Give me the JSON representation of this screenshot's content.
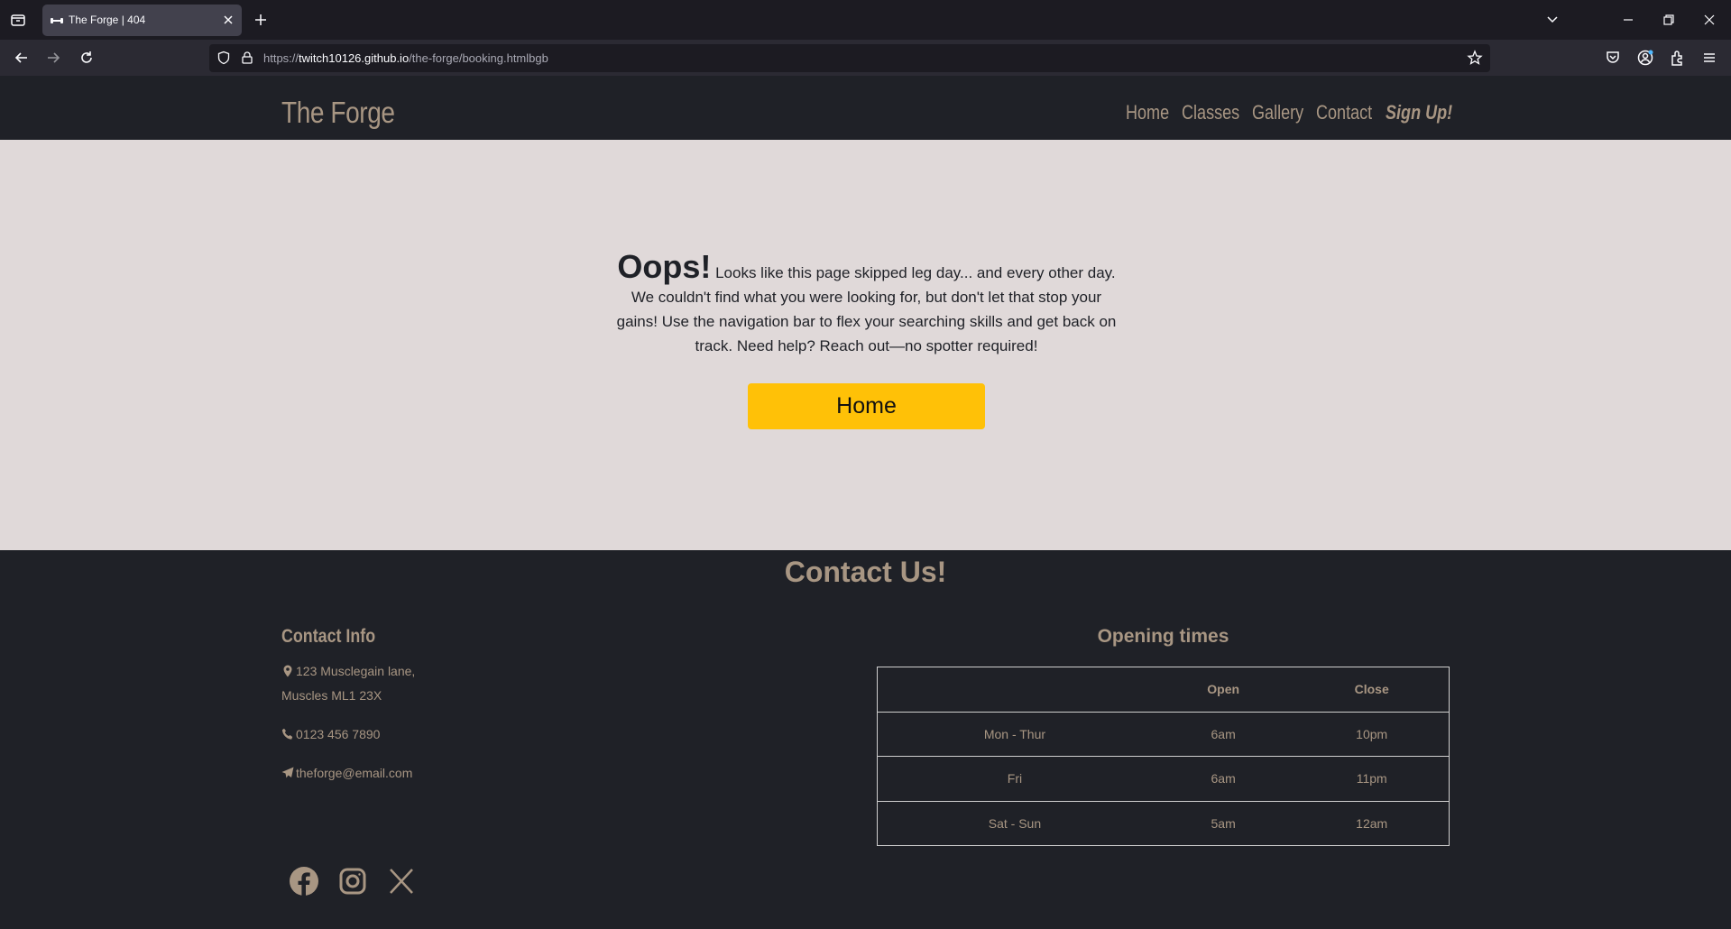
{
  "browser": {
    "tab_title": "The Forge | 404",
    "url_prefix": "https://",
    "url_host": "twitch10126.github.io",
    "url_path": "/the-forge/booking.htmlbgb"
  },
  "site": {
    "brand": "The Forge",
    "nav": [
      "Home",
      "Classes",
      "Gallery",
      "Contact",
      "Sign Up!"
    ]
  },
  "error": {
    "heading": "Oops!",
    "message": "Looks like this page skipped leg day... and every other day. We couldn't find what you were looking for, but don't let that stop your gains! Use the navigation bar to flex your searching skills and get back on track. Need help? Reach out—no spotter required!",
    "button": "Home",
    "button_color": "#ffc107"
  },
  "footer": {
    "title": "Contact Us!",
    "contact_info_title": "Contact Info",
    "address_line1": "123 Musclegain lane,",
    "address_line2": "Muscles ML1 23X",
    "phone": "0123 456 7890",
    "email": "theforge@email.com",
    "socials": [
      "facebook-icon",
      "instagram-icon",
      "x-icon"
    ],
    "hours_title": "Opening times",
    "hours_headers": [
      "",
      "Open",
      "Close"
    ],
    "hours_rows": [
      [
        "Mon - Thur",
        "6am",
        "10pm"
      ],
      [
        "Fri",
        "6am",
        "11pm"
      ],
      [
        "Sat - Sun",
        "5am",
        "12am"
      ]
    ],
    "accent_color": "#a89683"
  }
}
